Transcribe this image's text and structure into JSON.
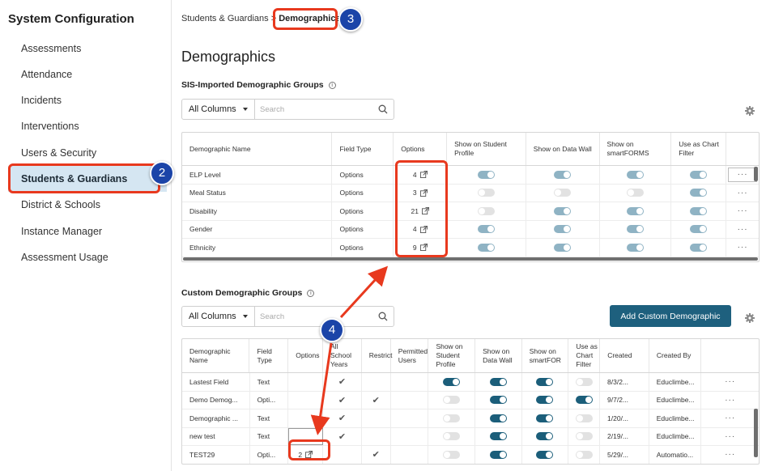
{
  "sidebar": {
    "title": "System Configuration",
    "items": [
      {
        "label": "Assessments"
      },
      {
        "label": "Attendance"
      },
      {
        "label": "Incidents"
      },
      {
        "label": "Interventions"
      },
      {
        "label": "Users & Security"
      },
      {
        "label": "Students & Guardians",
        "active": true
      },
      {
        "label": "District & Schools"
      },
      {
        "label": "Instance Manager"
      },
      {
        "label": "Assessment Usage"
      }
    ]
  },
  "breadcrumb": {
    "parent": "Students & Guardians",
    "separator": ">",
    "current": "Demographics"
  },
  "page_title": "Demographics",
  "sis": {
    "title": "SIS-Imported Demographic Groups",
    "filter": {
      "selected": "All Columns",
      "placeholder": "Search"
    },
    "headers": [
      "Demographic Name",
      "Field Type",
      "Options",
      "Show on Student Profile",
      "Show on Data Wall",
      "Show on smartFORMS",
      "Use as Chart Filter",
      ""
    ],
    "rows": [
      {
        "name": "ELP Level",
        "type": "Options",
        "options": "4",
        "profile": "on",
        "wall": "on",
        "forms": "on",
        "chart": "on"
      },
      {
        "name": "Meal Status",
        "type": "Options",
        "options": "3",
        "profile": "off",
        "wall": "off",
        "forms": "off",
        "chart": "on"
      },
      {
        "name": "Disability",
        "type": "Options",
        "options": "21",
        "profile": "off",
        "wall": "on",
        "forms": "on",
        "chart": "on"
      },
      {
        "name": "Gender",
        "type": "Options",
        "options": "4",
        "profile": "on",
        "wall": "on",
        "forms": "on",
        "chart": "on"
      },
      {
        "name": "Ethnicity",
        "type": "Options",
        "options": "9",
        "profile": "on",
        "wall": "on",
        "forms": "on",
        "chart": "on"
      }
    ],
    "more_label": "···"
  },
  "custom": {
    "title": "Custom Demographic Groups",
    "filter": {
      "selected": "All Columns",
      "placeholder": "Search"
    },
    "add_label": "Add Custom Demographic",
    "headers": [
      "Demographic Name",
      "Field Type",
      "Options",
      "All School Years",
      "Restrict",
      "Permitted Users",
      "Show on Student Profile",
      "Show on Data Wall",
      "Show on smartFOR",
      "Use as Chart Filter",
      "Created",
      "Created By",
      ""
    ],
    "rows": [
      {
        "name": "Lastest Field",
        "type": "Text",
        "options": "",
        "all_years": "✔",
        "restrict": "",
        "permitted": "",
        "profile": "on",
        "wall": "on",
        "forms": "on",
        "chart": "off",
        "created": "8/3/2...",
        "by": "Educlimbe..."
      },
      {
        "name": "Demo Demog...",
        "type": "Opti...",
        "options": "",
        "all_years": "✔",
        "restrict": "✔",
        "permitted": "",
        "profile": "off",
        "wall": "on",
        "forms": "on",
        "chart": "on",
        "created": "9/7/2...",
        "by": "Educlimbe..."
      },
      {
        "name": "Demographic ...",
        "type": "Text",
        "options": "",
        "all_years": "✔",
        "restrict": "",
        "permitted": "",
        "profile": "off",
        "wall": "on",
        "forms": "on",
        "chart": "off",
        "created": "1/20/...",
        "by": "Educlimbe..."
      },
      {
        "name": "new test",
        "type": "Text",
        "options": "",
        "all_years": "✔",
        "restrict": "",
        "permitted": "",
        "profile": "off",
        "wall": "on",
        "forms": "on",
        "chart": "off",
        "created": "2/19/...",
        "by": "Educlimbe..."
      },
      {
        "name": "TEST29",
        "type": "Opti...",
        "options": "2",
        "all_years": "",
        "restrict": "✔",
        "permitted": "",
        "profile": "off",
        "wall": "on",
        "forms": "on",
        "chart": "off",
        "created": "5/29/...",
        "by": "Automatio..."
      }
    ]
  },
  "annotations": {
    "step2": "2",
    "step3": "3",
    "step4": "4"
  },
  "colors": {
    "accent": "#1e607e",
    "highlight": "#e8391e",
    "badge": "#1b44a8",
    "active_nav": "#d5e6f2"
  }
}
